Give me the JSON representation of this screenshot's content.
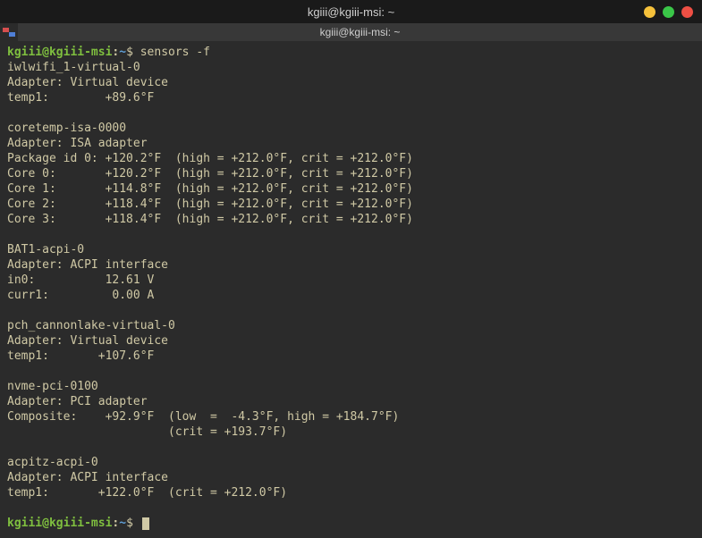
{
  "window": {
    "title": "kgiii@kgiii-msi: ~"
  },
  "tab": {
    "label": "kgiii@kgiii-msi: ~"
  },
  "prompt1": {
    "user": "kgiii@kgiii-msi",
    "colon": ":",
    "path": "~",
    "dollar": "$ ",
    "cmd": "sensors -f"
  },
  "prompt2": {
    "user": "kgiii@kgiii-msi",
    "colon": ":",
    "path": "~",
    "dollar": "$ "
  },
  "blocks": {
    "iwlwifi": {
      "name": "iwlwifi_1-virtual-0",
      "adapter": "Adapter: Virtual device",
      "temp1": "temp1:        +89.6°F  "
    },
    "coretemp": {
      "name": "coretemp-isa-0000",
      "adapter": "Adapter: ISA adapter",
      "package": "Package id 0: +120.2°F  (high = +212.0°F, crit = +212.0°F)",
      "core0": "Core 0:       +120.2°F  (high = +212.0°F, crit = +212.0°F)",
      "core1": "Core 1:       +114.8°F  (high = +212.0°F, crit = +212.0°F)",
      "core2": "Core 2:       +118.4°F  (high = +212.0°F, crit = +212.0°F)",
      "core3": "Core 3:       +118.4°F  (high = +212.0°F, crit = +212.0°F)"
    },
    "bat1": {
      "name": "BAT1-acpi-0",
      "adapter": "Adapter: ACPI interface",
      "in0": "in0:          12.61 V  ",
      "curr1": "curr1:         0.00 A  "
    },
    "pch": {
      "name": "pch_cannonlake-virtual-0",
      "adapter": "Adapter: Virtual device",
      "temp1": "temp1:       +107.6°F  "
    },
    "nvme": {
      "name": "nvme-pci-0100",
      "adapter": "Adapter: PCI adapter",
      "composite1": "Composite:    +92.9°F  (low  =  -4.3°F, high = +184.7°F)",
      "composite2": "                       (crit = +193.7°F)"
    },
    "acpitz": {
      "name": "acpitz-acpi-0",
      "adapter": "Adapter: ACPI interface",
      "temp1": "temp1:       +122.0°F  (crit = +212.0°F)"
    }
  }
}
